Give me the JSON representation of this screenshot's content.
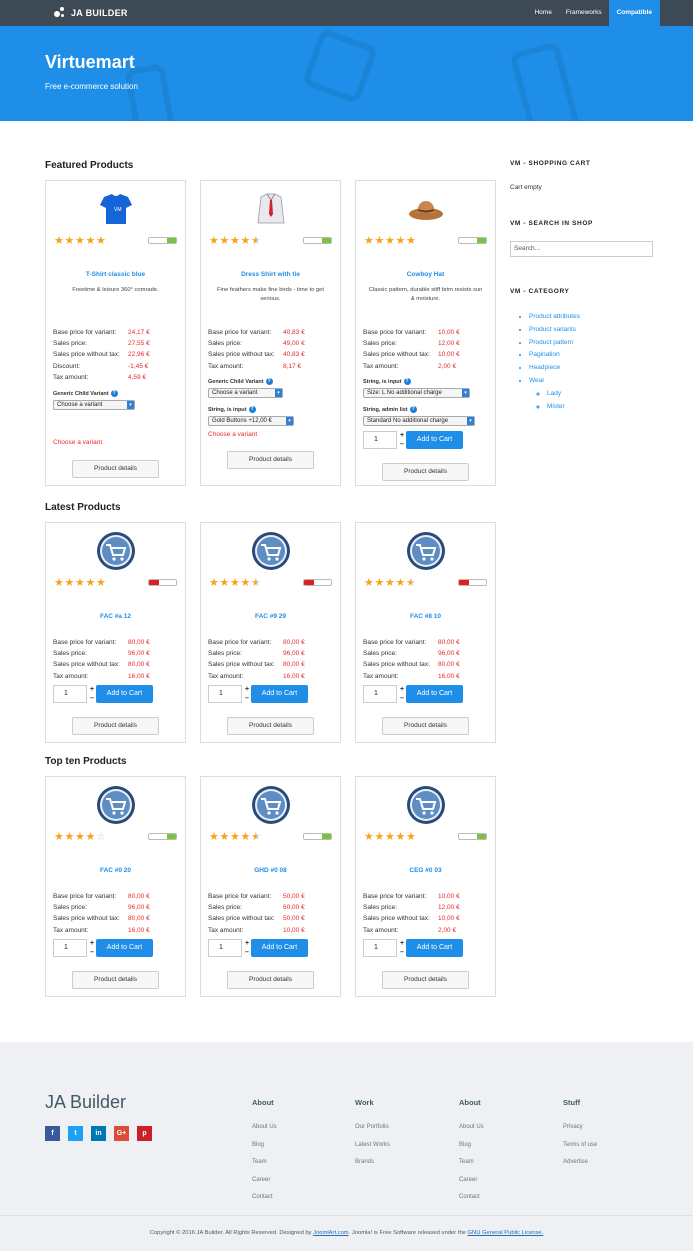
{
  "brand": "JA BUILDER",
  "nav": [
    "Home",
    "Frameworks",
    "Compatible"
  ],
  "hero": {
    "title": "Virtuemart",
    "subtitle": "Free e-commerce solution"
  },
  "sections": {
    "featured": "Featured Products",
    "latest": "Latest Products",
    "top": "Top ten Products"
  },
  "labels": {
    "base": "Base price for variant:",
    "sales": "Sales price:",
    "without_tax": "Sales price without tax:",
    "discount": "Discount:",
    "tax": "Tax amount:",
    "add_to_cart": "Add to Cart",
    "details": "Product details",
    "choose_variant": "Choose a variant",
    "generic_child": "Generic Child Variant",
    "string_input": "String, is input",
    "string_admin": "String, admin list",
    "qty": "1"
  },
  "featured": [
    {
      "name": "T-Shirt classic blue",
      "desc": "Freetime & leisure 360° comrade.",
      "rating": 5,
      "stock": "green",
      "base": "24,17 €",
      "sales": "27,55 €",
      "without_tax": "22,96 €",
      "discount": "-1,45 €",
      "tax": "4,59 €",
      "select1": "Choose a variant",
      "icon": "tshirt-icon"
    },
    {
      "name": "Dress Shirt with tie",
      "desc": "Fine feathers make fine birds - time to get serious.",
      "rating": 4.5,
      "stock": "green",
      "base": "40,83 €",
      "sales": "49,00 €",
      "without_tax": "40,83 €",
      "tax": "8,17 €",
      "select1": "Choose a variant",
      "select2": "Gold Buttons +12,00 €",
      "icon": "dress-shirt-icon"
    },
    {
      "name": "Cowboy Hat",
      "desc": "Classic pattern, durable stiff brim resists sun & moisture.",
      "rating": 5,
      "stock": "green",
      "base": "10,00 €",
      "sales": "12,00 €",
      "without_tax": "10,00 €",
      "tax": "2,00 €",
      "select1": "Size: L No additional charge",
      "select2": "Standard No additional charge",
      "icon": "cowboy-hat-icon"
    }
  ],
  "latest": [
    {
      "name": "FAC #a 12",
      "rating": 5,
      "stock": "red",
      "base": "80,00 €",
      "sales": "96,00 €",
      "without_tax": "80,00 €",
      "tax": "16,00 €"
    },
    {
      "name": "FAC #9 29",
      "rating": 4.5,
      "stock": "red",
      "base": "80,00 €",
      "sales": "96,00 €",
      "without_tax": "80,00 €",
      "tax": "16,00 €"
    },
    {
      "name": "FAC #8 10",
      "rating": 4.5,
      "stock": "red",
      "base": "80,00 €",
      "sales": "96,00 €",
      "without_tax": "80,00 €",
      "tax": "16,00 €"
    }
  ],
  "top": [
    {
      "name": "FAC #0 20",
      "rating": 4,
      "stock": "green",
      "base": "80,00 €",
      "sales": "96,00 €",
      "without_tax": "80,00 €",
      "tax": "16,00 €"
    },
    {
      "name": "GHD #0 08",
      "rating": 4.5,
      "stock": "green",
      "base": "50,00 €",
      "sales": "60,00 €",
      "without_tax": "50,00 €",
      "tax": "10,00 €"
    },
    {
      "name": "CEG #0 03",
      "rating": 5,
      "stock": "green",
      "base": "10,00 €",
      "sales": "12,00 €",
      "without_tax": "10,00 €",
      "tax": "2,00 €"
    }
  ],
  "sidebar": {
    "cart_title": "VM - SHOPPING CART",
    "cart_empty": "Cart empty",
    "search_title": "VM - SEARCH IN SHOP",
    "search_placeholder": "Search...",
    "category_title": "VM - CATEGORY",
    "categories": [
      "Product attributes",
      "Product variants",
      "Product pattern",
      "Pagination",
      "Headpiece",
      "Wear"
    ],
    "subcategories": [
      "Lady",
      "Mister"
    ]
  },
  "footer": {
    "brand": "JA Builder",
    "social": [
      "f",
      "t",
      "in",
      "G+",
      "p"
    ],
    "cols": [
      {
        "title": "About",
        "links": [
          "About Us",
          "Blog",
          "Team",
          "Career",
          "Contact"
        ]
      },
      {
        "title": "Work",
        "links": [
          "Our Portfolio",
          "Latest Works",
          "Brands"
        ]
      },
      {
        "title": "About",
        "links": [
          "About Us",
          "Blog",
          "Team",
          "Career",
          "Contact"
        ]
      },
      {
        "title": "Stuff",
        "links": [
          "Privacy",
          "Terms of use",
          "Advertise"
        ]
      }
    ],
    "copyright_pre": "Copyright © 2016 JA Builder. All Rights Reserved. Designed by ",
    "copyright_link1": "JoomlArt.com",
    "copyright_mid": ". Joomla! is Free Software released under the ",
    "copyright_link2": "GNU General Public License."
  }
}
